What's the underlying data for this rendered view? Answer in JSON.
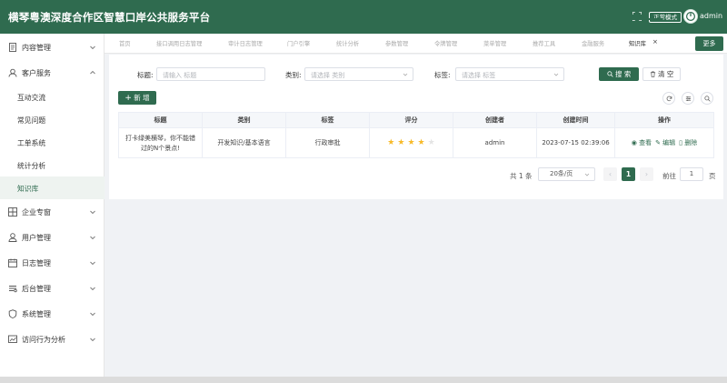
{
  "header": {
    "title": "横琴粤澳深度合作区智慧口岸公共服务平台",
    "mode_label": "正常模式",
    "username": "admin"
  },
  "sidebar": {
    "items": [
      {
        "label": "内容管理",
        "icon": "document-icon"
      },
      {
        "label": "客户服务",
        "icon": "customer-icon",
        "expanded": true
      },
      {
        "label": "企业专窗",
        "icon": "grid-icon"
      },
      {
        "label": "用户管理",
        "icon": "user-icon"
      },
      {
        "label": "日志管理",
        "icon": "calendar-icon"
      },
      {
        "label": "后台管理",
        "icon": "backend-icon"
      },
      {
        "label": "系统管理",
        "icon": "shield-icon"
      },
      {
        "label": "访问行为分析",
        "icon": "chart-icon"
      }
    ],
    "sub_items": [
      {
        "label": "互动交流"
      },
      {
        "label": "常见问题"
      },
      {
        "label": "工单系统"
      },
      {
        "label": "统计分析"
      },
      {
        "label": "知识库",
        "active": true
      }
    ]
  },
  "tabs": {
    "items": [
      "首页",
      "接口调用日志管理",
      "审计日志管理",
      "门户引擎",
      "统计分析",
      "参数管理",
      "令牌管理",
      "菜单管理",
      "推荐工具",
      "金融服务",
      "知识库"
    ],
    "active": "知识库",
    "more_label": "更多"
  },
  "search": {
    "title_label": "标题:",
    "title_placeholder": "请输入 标题",
    "category_label": "类别:",
    "category_placeholder": "请选择 类别",
    "tag_label": "标签:",
    "tag_placeholder": "请选择 标签",
    "search_button": "搜 索",
    "clear_button": "清 空"
  },
  "toolbar": {
    "add_button": "新 增"
  },
  "table": {
    "columns": [
      "标题",
      "类别",
      "标签",
      "评分",
      "创建者",
      "创建时间",
      "操作"
    ],
    "rows": [
      {
        "title_line1": "打卡绿美横琴，你不能错",
        "title_line2": "过的N个景点!",
        "category": "开发知识/基本语言",
        "tag": "行政审批",
        "rating": 4,
        "rating_max": 5,
        "creator": "admin",
        "created_at": "2023-07-15 02:39:06",
        "actions": {
          "view": "查看",
          "edit": "编辑",
          "delete": "删除"
        }
      }
    ]
  },
  "pagination": {
    "total": "共 1 条",
    "page_size": "20条/页",
    "current_page": "1",
    "goto_label": "前往",
    "goto_value": "1",
    "page_suffix": "页"
  },
  "colors": {
    "primary": "#2f6b4f",
    "star": "#f7ba2a"
  }
}
